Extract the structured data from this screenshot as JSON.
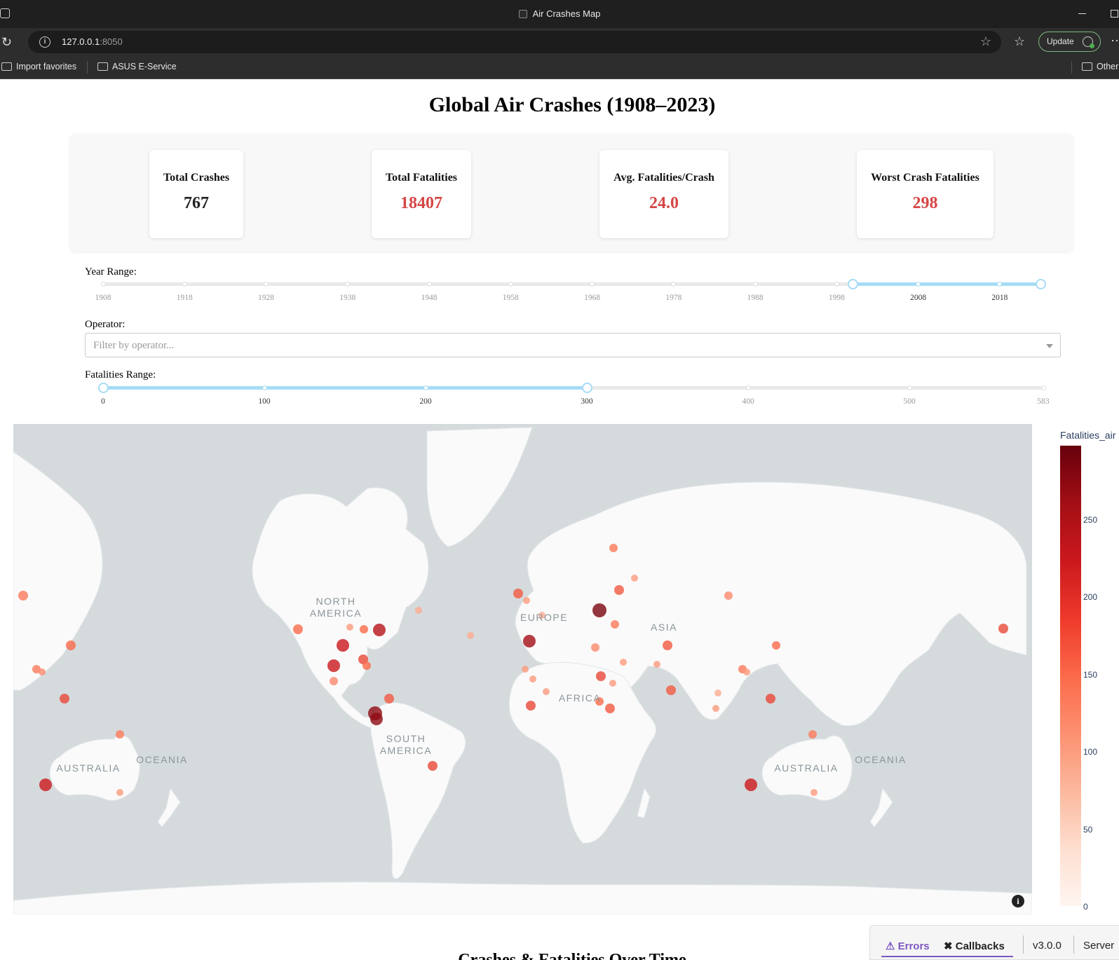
{
  "browser": {
    "window_title": "Air Crashes Map",
    "url_host": "127.0.0.1",
    "url_port": ":8050",
    "update_label": "Update",
    "bookmarks": [
      "Import favorites",
      "ASUS E-Service"
    ],
    "other_bookmarks": "Other"
  },
  "page": {
    "title": "Global Air Crashes (1908–2023)",
    "section_peek": "Crashes & Fatalities Over Time"
  },
  "stats": [
    {
      "label": "Total Crashes",
      "value": "767",
      "color": "#222222"
    },
    {
      "label": "Total Fatalities",
      "value": "18407",
      "color": "#d64545"
    },
    {
      "label": "Avg. Fatalities/Crash",
      "value": "24.0",
      "color": "#d64545"
    },
    {
      "label": "Worst Crash Fatalities",
      "value": "298",
      "color": "#d64545"
    }
  ],
  "filters": {
    "year_label": "Year Range:",
    "year_marks": [
      "1908",
      "1918",
      "1928",
      "1938",
      "1948",
      "1958",
      "1968",
      "1978",
      "1988",
      "1998",
      "2008",
      "2018"
    ],
    "year_min": 1908,
    "year_max": 2023,
    "year_selected": [
      2000,
      2023
    ],
    "operator_label": "Operator:",
    "operator_placeholder": "Filter by operator...",
    "fatal_label": "Fatalities Range:",
    "fatal_marks": [
      "0",
      "100",
      "200",
      "300",
      "400",
      "500",
      "583"
    ],
    "fatal_min": 0,
    "fatal_max": 583,
    "fatal_selected": [
      0,
      300
    ]
  },
  "map": {
    "continent_labels": [
      [
        "NORTH",
        "AMERICA"
      ],
      [
        "EUROPE"
      ],
      [
        "ASIA"
      ],
      [
        "AFRICA"
      ],
      [
        "SOUTH",
        "AMERICA"
      ],
      [
        "AUSTRALIA"
      ],
      [
        "OCEANIA"
      ],
      [
        "AUSTRALIA"
      ],
      [
        "OCEANIA"
      ]
    ],
    "info_icon": "info-icon",
    "colors": {
      "ocean": "#d5dadd",
      "land": "#fafafa",
      "accent": "#a6dcf5"
    }
  },
  "colorbar": {
    "title": "Fatalities_air",
    "ticks": [
      "250",
      "200",
      "150",
      "100",
      "50",
      "0"
    ],
    "colorscale": "Reds"
  },
  "dash_debug": {
    "errors": "Errors",
    "callbacks": "Callbacks",
    "version": "v3.0.0",
    "server": "Server"
  }
}
